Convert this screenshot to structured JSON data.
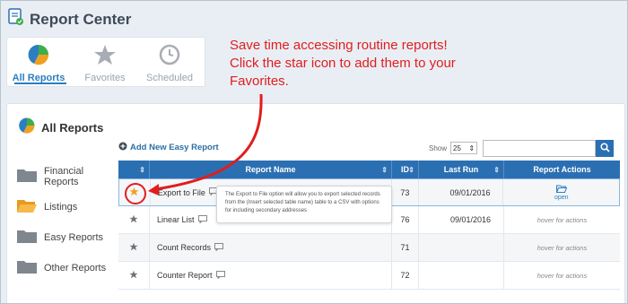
{
  "app": {
    "title": "Report Center"
  },
  "tabs": [
    {
      "label": "All Reports",
      "active": true,
      "icon": "pie-chart-icon"
    },
    {
      "label": "Favorites",
      "active": false,
      "icon": "star-icon"
    },
    {
      "label": "Scheduled",
      "active": false,
      "icon": "clock-icon"
    }
  ],
  "callout": {
    "text": "Save time accessing routine reports!  Click the star icon to add them to your Favorites."
  },
  "section": {
    "title": "All Reports"
  },
  "sidebar": {
    "items": [
      {
        "label": "Financial Reports",
        "open": false
      },
      {
        "label": "Listings",
        "open": true
      },
      {
        "label": "Easy Reports",
        "open": false
      },
      {
        "label": "Other Reports",
        "open": false
      }
    ]
  },
  "toolbar": {
    "add_label": "Add New Easy Report",
    "show_label": "Show",
    "show_value": "25",
    "search_placeholder": ""
  },
  "table": {
    "headers": {
      "name": "Report Name",
      "id": "ID",
      "last_run": "Last Run",
      "actions": "Report Actions"
    },
    "rows": [
      {
        "name": "Export to File",
        "id": "73",
        "last_run": "09/01/2016",
        "action": "open",
        "favorite": true
      },
      {
        "name": "Linear List",
        "id": "76",
        "last_run": "09/01/2016",
        "action": "hover for actions",
        "favorite": false
      },
      {
        "name": "Count Records",
        "id": "71",
        "last_run": "",
        "action": "hover for actions",
        "favorite": false
      },
      {
        "name": "Counter Report",
        "id": "72",
        "last_run": "",
        "action": "hover for actions",
        "favorite": false
      }
    ]
  },
  "tooltip": {
    "text": "The Export to File option will allow you to export selected records from the (Insert selected table name) table to a CSV with options for including secondary addresses"
  },
  "colors": {
    "accent": "#2b6fb3",
    "callout": "#e11d1d",
    "star": "#f0a020"
  }
}
